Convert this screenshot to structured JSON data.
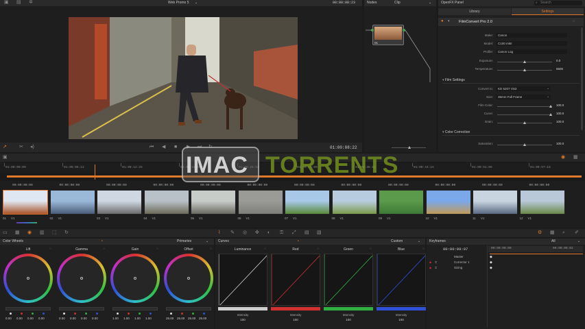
{
  "viewer": {
    "title": "Web Promo 5",
    "timecode_top": "00:00:08:23",
    "timecode_bottom": "01:00:08:22"
  },
  "nodes": {
    "title": "Nodes",
    "mode": "Clip",
    "node_label": "01"
  },
  "openfx": {
    "title": "OpenFX Panel",
    "search_placeholder": "Search",
    "tabs": [
      "Library",
      "Settings"
    ],
    "plugin_name": "FilmConvert Pro 2.0",
    "camera": [
      {
        "label": "Make:",
        "value": "Canon"
      },
      {
        "label": "Model:",
        "value": "C100 mkII"
      },
      {
        "label": "Profile:",
        "value": "Canon Log"
      }
    ],
    "exposure": {
      "label": "Exposure:",
      "value": "0.0",
      "level": 0.5
    },
    "temperature": {
      "label": "Temperature:",
      "value": "5500",
      "level": 0.5
    },
    "film_settings": "Film Settings",
    "convert_to": {
      "label": "Convert to:",
      "value": "KD 5207 Vis3"
    },
    "size": {
      "label": "Size:",
      "value": "35mm Full Frame"
    },
    "film_color": {
      "label": "Film Color:",
      "value": "100.0",
      "level": 1.0
    },
    "curve": {
      "label": "Curve:",
      "value": "100.0",
      "level": 1.0
    },
    "grain": {
      "label": "Grain:",
      "value": "100.0",
      "level": 0.5
    },
    "color_correction": "Color Correction",
    "saturation": {
      "label": "Saturation:",
      "value": "100.0"
    }
  },
  "timeline": {
    "ruler": [
      "01:00:00:00",
      "01:00:06:12",
      "01:00:12:25",
      "01:00:19:06",
      "01:00:25:18",
      "01:00:32:00",
      "01:00:38:12",
      "01:00:44:24",
      "01:00:51:06",
      "01:00:57:18"
    ],
    "clips": [
      {
        "tc": "00:00:00:00",
        "idx": "01",
        "track": "V1"
      },
      {
        "tc": "00:00:00:00",
        "idx": "02",
        "track": "V1"
      },
      {
        "tc": "00:00:00:00",
        "idx": "03",
        "track": "V1"
      },
      {
        "tc": "00:00:00:00",
        "idx": "04",
        "track": "V1"
      },
      {
        "tc": "00:00:00:00",
        "idx": "05",
        "track": "V1"
      },
      {
        "tc": "00:00:00:00",
        "idx": "06",
        "track": "V1"
      },
      {
        "tc": "00:00:00:00",
        "idx": "07",
        "track": "V1"
      },
      {
        "tc": "00:00:00:00",
        "idx": "08",
        "track": "V1"
      },
      {
        "tc": "00:00:00:00",
        "idx": "09",
        "track": "V1"
      },
      {
        "tc": "00:00:00:00",
        "idx": "10",
        "track": "V1"
      },
      {
        "tc": "00:00:00:00",
        "idx": "11",
        "track": "V1"
      },
      {
        "tc": "00:00:00:00",
        "idx": "12",
        "track": "V1"
      }
    ]
  },
  "color_wheels": {
    "title": "Color Wheels",
    "mode": "Primaries",
    "wheels": [
      {
        "name": "Lift",
        "values": [
          "0.00",
          "0.00",
          "0.00",
          "0.00"
        ]
      },
      {
        "name": "Gamma",
        "values": [
          "0.00",
          "0.00",
          "0.00",
          "0.00"
        ]
      },
      {
        "name": "Gain",
        "values": [
          "1.00",
          "1.00",
          "1.00",
          "1.00"
        ]
      },
      {
        "name": "Offset",
        "values": [
          "25.00",
          "25.00",
          "25.00",
          "25.00"
        ]
      }
    ]
  },
  "curves": {
    "title": "Curves",
    "mode": "Custom",
    "channels": [
      {
        "name": "Luminance",
        "intensity_label": "Intensity",
        "intensity": "100",
        "color": "#cccccc"
      },
      {
        "name": "Red",
        "intensity_label": "Intensity",
        "intensity": "100",
        "color": "#d03030"
      },
      {
        "name": "Green",
        "intensity_label": "Intensity",
        "intensity": "100",
        "color": "#30b040"
      },
      {
        "name": "Blue",
        "intensity_label": "Intensity",
        "intensity": "100",
        "color": "#3050d8"
      }
    ]
  },
  "keyframes": {
    "title": "Keyframes",
    "filter": "All",
    "timecode": "00:00:09:07",
    "track_tc_a": "00:00:00:00",
    "track_tc_b": "00:00:09:02",
    "tracks": [
      "Master",
      "Corrector 1",
      "Sizing"
    ]
  },
  "watermark": {
    "part1": "IMAC",
    "part2": "TORRENTS"
  },
  "accent": "#e07a2a"
}
